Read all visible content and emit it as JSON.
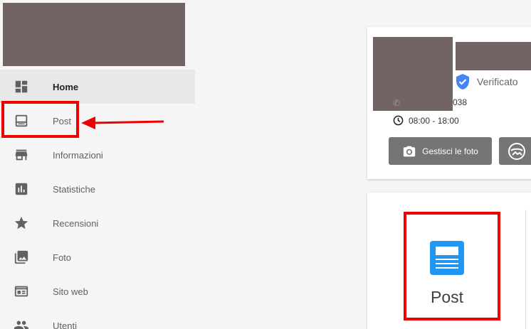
{
  "sidebar": {
    "items": [
      {
        "label": "Home",
        "icon": "dashboard-icon",
        "active": true
      },
      {
        "label": "Post",
        "icon": "post-icon"
      },
      {
        "label": "Informazioni",
        "icon": "store-icon"
      },
      {
        "label": "Statistiche",
        "icon": "insights-icon"
      },
      {
        "label": "Recensioni",
        "icon": "star-icon"
      },
      {
        "label": "Foto",
        "icon": "photo-icon"
      },
      {
        "label": "Sito web",
        "icon": "website-icon"
      },
      {
        "label": "Utenti",
        "icon": "people-icon"
      }
    ]
  },
  "business_card": {
    "verified_label": "Verificato",
    "phone_suffix": "038",
    "hours": "08:00 - 18:00",
    "manage_photos_label": "Gestisci le foto"
  },
  "post_card": {
    "label": "Post"
  },
  "colors": {
    "highlight": "#ee0000",
    "verified_blue": "#4285f4",
    "post_blue": "#2196f3",
    "active_item_bg": "#e8e8e8"
  }
}
